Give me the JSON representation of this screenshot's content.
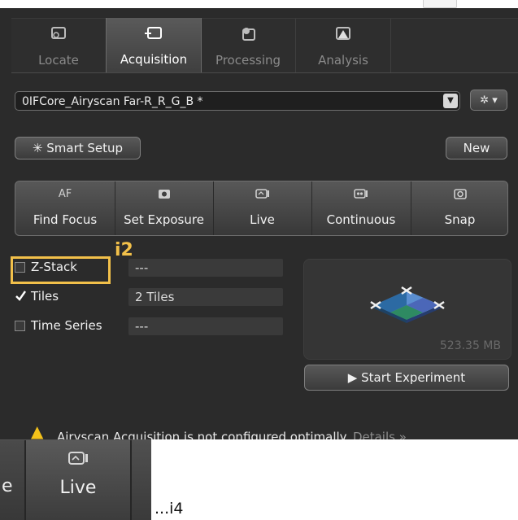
{
  "tabs": [
    {
      "label": "Locate",
      "icon": "locate-icon"
    },
    {
      "label": "Acquisition",
      "icon": "acquisition-icon"
    },
    {
      "label": "Processing",
      "icon": "processing-icon"
    },
    {
      "label": "Analysis",
      "icon": "analysis-icon"
    }
  ],
  "experiment": {
    "selected": "0IFCore_Airyscan Far-R_R_G_B *"
  },
  "buttons": {
    "smart_setup": "Smart Setup",
    "new": "New",
    "start_experiment": "Start Experiment"
  },
  "tools": [
    {
      "top": "AF",
      "label": "Find Focus"
    },
    {
      "top": "",
      "label": "Set Exposure"
    },
    {
      "top": "",
      "label": "Live"
    },
    {
      "top": "",
      "label": "Continuous"
    },
    {
      "top": "",
      "label": "Snap"
    }
  ],
  "dimensions": [
    {
      "label": "Z-Stack",
      "checked": false,
      "value": "---"
    },
    {
      "label": "Tiles",
      "checked": true,
      "value": "2 Tiles"
    },
    {
      "label": "Time Series",
      "checked": false,
      "value": "---"
    }
  ],
  "preview": {
    "size": "523.35 MB"
  },
  "warning": {
    "text": "Airyscan Acquisition is not configured optimally.",
    "link": "Details »"
  },
  "annotations": {
    "i2": "i2",
    "i4": "...i4"
  },
  "crop": {
    "label": "Live",
    "left_fragment": "e"
  },
  "colors": {
    "highlight": "#f2c04a",
    "warning": "#f4c21a"
  }
}
